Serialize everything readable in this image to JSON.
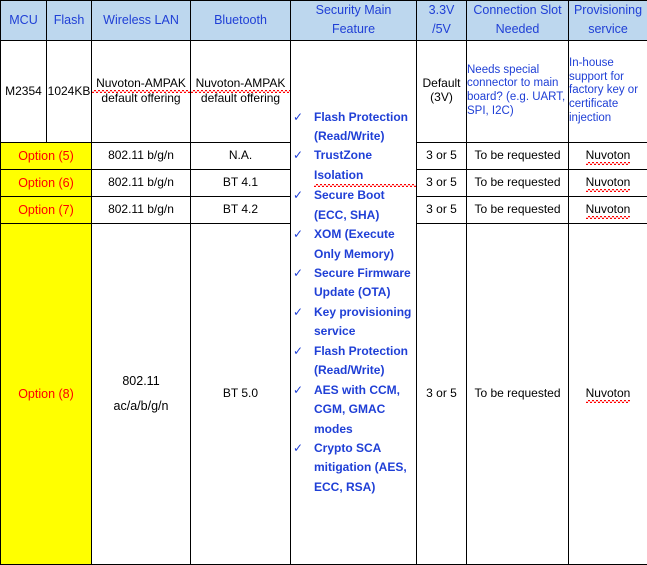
{
  "table": {
    "columns": [
      {
        "key": "mcu",
        "label": "MCU"
      },
      {
        "key": "flash",
        "label": "Flash"
      },
      {
        "key": "wlan",
        "label": "Wireless LAN"
      },
      {
        "key": "bluetooth",
        "label": "Bluetooth"
      },
      {
        "key": "security",
        "label": "Security Main Feature"
      },
      {
        "key": "voltage",
        "label": "3.3V /5V"
      },
      {
        "key": "connection",
        "label": "Connection Slot Needed"
      },
      {
        "key": "provisioning",
        "label": "Provisioning service"
      }
    ],
    "header_lines": {
      "mcu": [
        "MCU"
      ],
      "flash": [
        "Flash"
      ],
      "wlan": [
        "Wireless LAN"
      ],
      "bluetooth": [
        "Bluetooth"
      ],
      "security": [
        "Security Main",
        "Feature"
      ],
      "voltage": [
        "3.3V",
        "/5V"
      ],
      "connection": [
        "Connection Slot",
        "Needed"
      ],
      "provisioning": [
        "Provisioning",
        "service"
      ]
    },
    "base_row": {
      "mcu": "M2354",
      "flash": "1024KB",
      "wlan": "Nuvoton-AMPAK default offering",
      "wlan_l1": "Nuvoton-AMPAK",
      "wlan_l2": "default offering",
      "bluetooth": "Nuvoton-AMPAK default offering",
      "bt_l1": "Nuvoton-AMPAK",
      "bt_l2": "default offering",
      "voltage_l1": "Default",
      "voltage_l2": "(3V)",
      "connection": "Needs special connector to main board? (e.g. UART, SPI, I2C)",
      "provisioning": "In-house support for factory key or certificate injection"
    },
    "option_rows": [
      {
        "option": "Option (5)",
        "wlan": "802.11 b/g/n",
        "bluetooth": "N.A.",
        "voltage": "3 or 5",
        "connection": "To be requested",
        "provisioning": "Nuvoton"
      },
      {
        "option": "Option (6)",
        "wlan": "802.11 b/g/n",
        "bluetooth": "BT 4.1",
        "voltage": "3 or 5",
        "connection": "To be requested",
        "provisioning": "Nuvoton"
      },
      {
        "option": "Option (7)",
        "wlan": "802.11 b/g/n",
        "bluetooth": "BT 4.2",
        "voltage": "3 or 5",
        "connection": "To be requested",
        "provisioning": "Nuvoton"
      },
      {
        "option": "Option (8)",
        "wlan": "802.11 ac/a/b/g/n",
        "wlan_l1": "802.11",
        "wlan_l2": "ac/a/b/g/n",
        "bluetooth": "BT 5.0",
        "voltage": "3 or 5",
        "connection": "To be requested",
        "provisioning": "Nuvoton"
      }
    ],
    "security_features": [
      "Flash Protection (Read/Write)",
      "TrustZone Isolation",
      "Secure Boot (ECC, SHA)",
      "XOM (Execute Only Memory)",
      "Secure Firmware Update (OTA)",
      "Key provisioning service",
      "Flash Protection (Read/Write)",
      "AES with CCM, CGM, GMAC modes",
      "Crypto SCA mitigation (AES, ECC, RSA)"
    ],
    "check_glyph": "✓",
    "colors": {
      "header_bg": "#BDD7EE",
      "header_text": "#1F3FD6",
      "blue_text": "#1F3FD6",
      "option_bg": "#FFFF00",
      "option_text": "#FF0000",
      "border": "#000000",
      "spellcheck_underline": "#FF0000"
    }
  }
}
